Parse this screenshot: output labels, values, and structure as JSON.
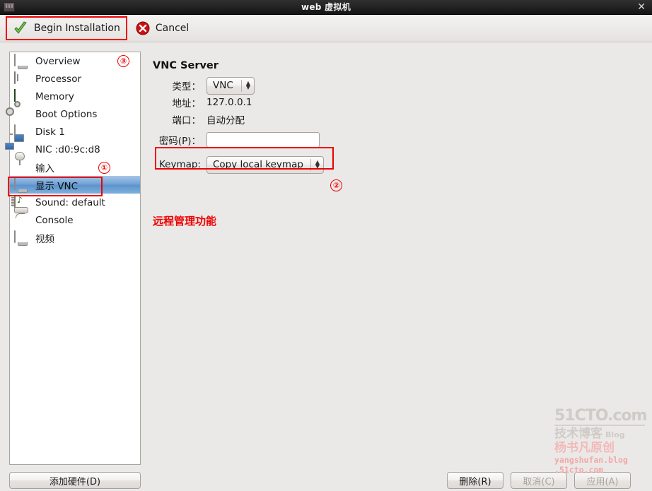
{
  "window": {
    "title": "web 虚拟机",
    "close_label": "✕",
    "app_icon": "virt-manager-icon"
  },
  "toolbar": {
    "begin_label": "Begin Installation",
    "cancel_label": "Cancel"
  },
  "sidebar": {
    "items": [
      {
        "label": "Overview",
        "icon": "monitor-icon"
      },
      {
        "label": "Processor",
        "icon": "cpu-chip-icon"
      },
      {
        "label": "Memory",
        "icon": "ram-icon"
      },
      {
        "label": "Boot Options",
        "icon": "gears-icon"
      },
      {
        "label": "Disk 1",
        "icon": "hard-disk-icon"
      },
      {
        "label": "NIC :d0:9c:d8",
        "icon": "network-icon"
      },
      {
        "label": "输入",
        "icon": "mouse-icon"
      },
      {
        "label": "显示 VNC",
        "icon": "display-icon",
        "selected": true
      },
      {
        "label": "Sound: default",
        "icon": "sound-card-icon"
      },
      {
        "label": "Console",
        "icon": "console-icon"
      },
      {
        "label": "视频",
        "icon": "video-icon"
      }
    ],
    "add_hardware_label": "添加硬件(D)"
  },
  "main": {
    "section_title": "VNC Server",
    "fields": {
      "type_label": "类型：",
      "type_value": "VNC",
      "address_label": "地址：",
      "address_value": "127.0.0.1",
      "port_label": "端口：",
      "port_value": "自动分配",
      "password_label": "密码(P)：",
      "password_value": "",
      "keymap_label": "Keymap:",
      "keymap_value": "Copy local keymap"
    }
  },
  "annotations": {
    "marker_1": "①",
    "marker_2": "②",
    "marker_3": "③",
    "note_text": "远程管理功能",
    "accent_color": "#ee0000"
  },
  "footer": {
    "delete_label": "删除(R)",
    "cancel_label": "取消(C)",
    "apply_label": "应用(A)"
  },
  "watermark": {
    "line1": "51CTO.com",
    "line2": "技术博客",
    "blog": "Blog",
    "line3": "杨书凡原创",
    "line4a": "yangshufan.blog",
    "line4b": ".51cto.com"
  }
}
